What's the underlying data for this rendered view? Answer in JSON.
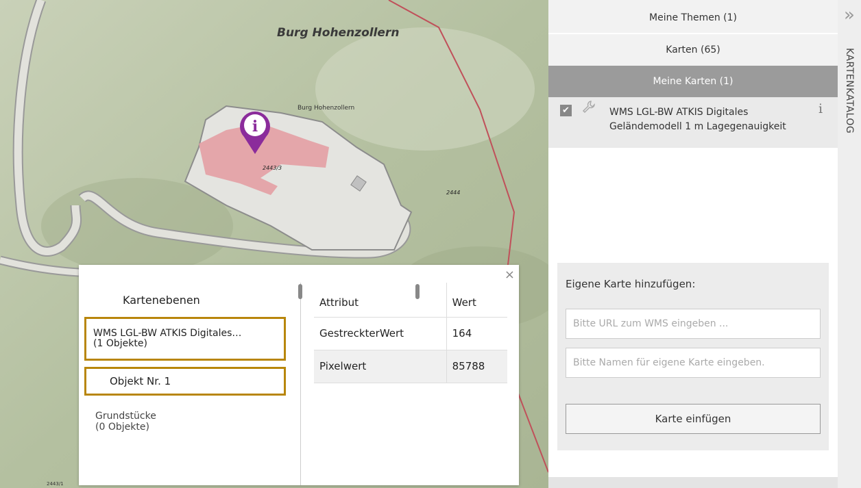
{
  "map": {
    "label_burg_large": "Burg Hohenzollern",
    "label_burg_small": "Burg Hohenzollern",
    "parcel_a": "2443/3",
    "parcel_b": "2444",
    "parcel_c": "2443/1",
    "marker_icon": "info-marker-icon",
    "marker_color": "#8b2c9b"
  },
  "popup": {
    "close_glyph": "×",
    "layers_header": "Kartenebenen",
    "layers": [
      {
        "name": "WMS LGL-BW ATKIS Digitales…",
        "count": "(1 Objekte)"
      },
      {
        "object": "Objekt Nr. 1"
      },
      {
        "name": "Grundstücke",
        "count": "(0 Objekte)"
      }
    ],
    "table": {
      "headers": [
        "Attribut",
        "Wert"
      ],
      "rows": [
        {
          "attr": "GestreckterWert",
          "value": "164"
        },
        {
          "attr": "Pixelwert",
          "value": "85788"
        }
      ]
    },
    "highlight_color": "#b8860b"
  },
  "panel": {
    "tabs": [
      "Meine Themen (1)",
      "Karten (65)",
      "Meine Karten (1)"
    ],
    "map_item": {
      "checked": true,
      "title": "WMS LGL-BW ATKIS Digitales Geländemodell 1 m Lagegenauigkeit",
      "info_glyph": "i",
      "check_glyph": "✔",
      "wrench_glyph": "🔧"
    },
    "add_map": {
      "heading": "Eigene Karte hinzufügen:",
      "url_placeholder": "Bitte URL zum WMS eingeben ...",
      "name_placeholder": "Bitte Namen für eigene Karte eingeben.",
      "button": "Karte einfügen"
    }
  },
  "catalog": {
    "collapse_glyph": "»",
    "label": "KARTENKATALOG"
  }
}
